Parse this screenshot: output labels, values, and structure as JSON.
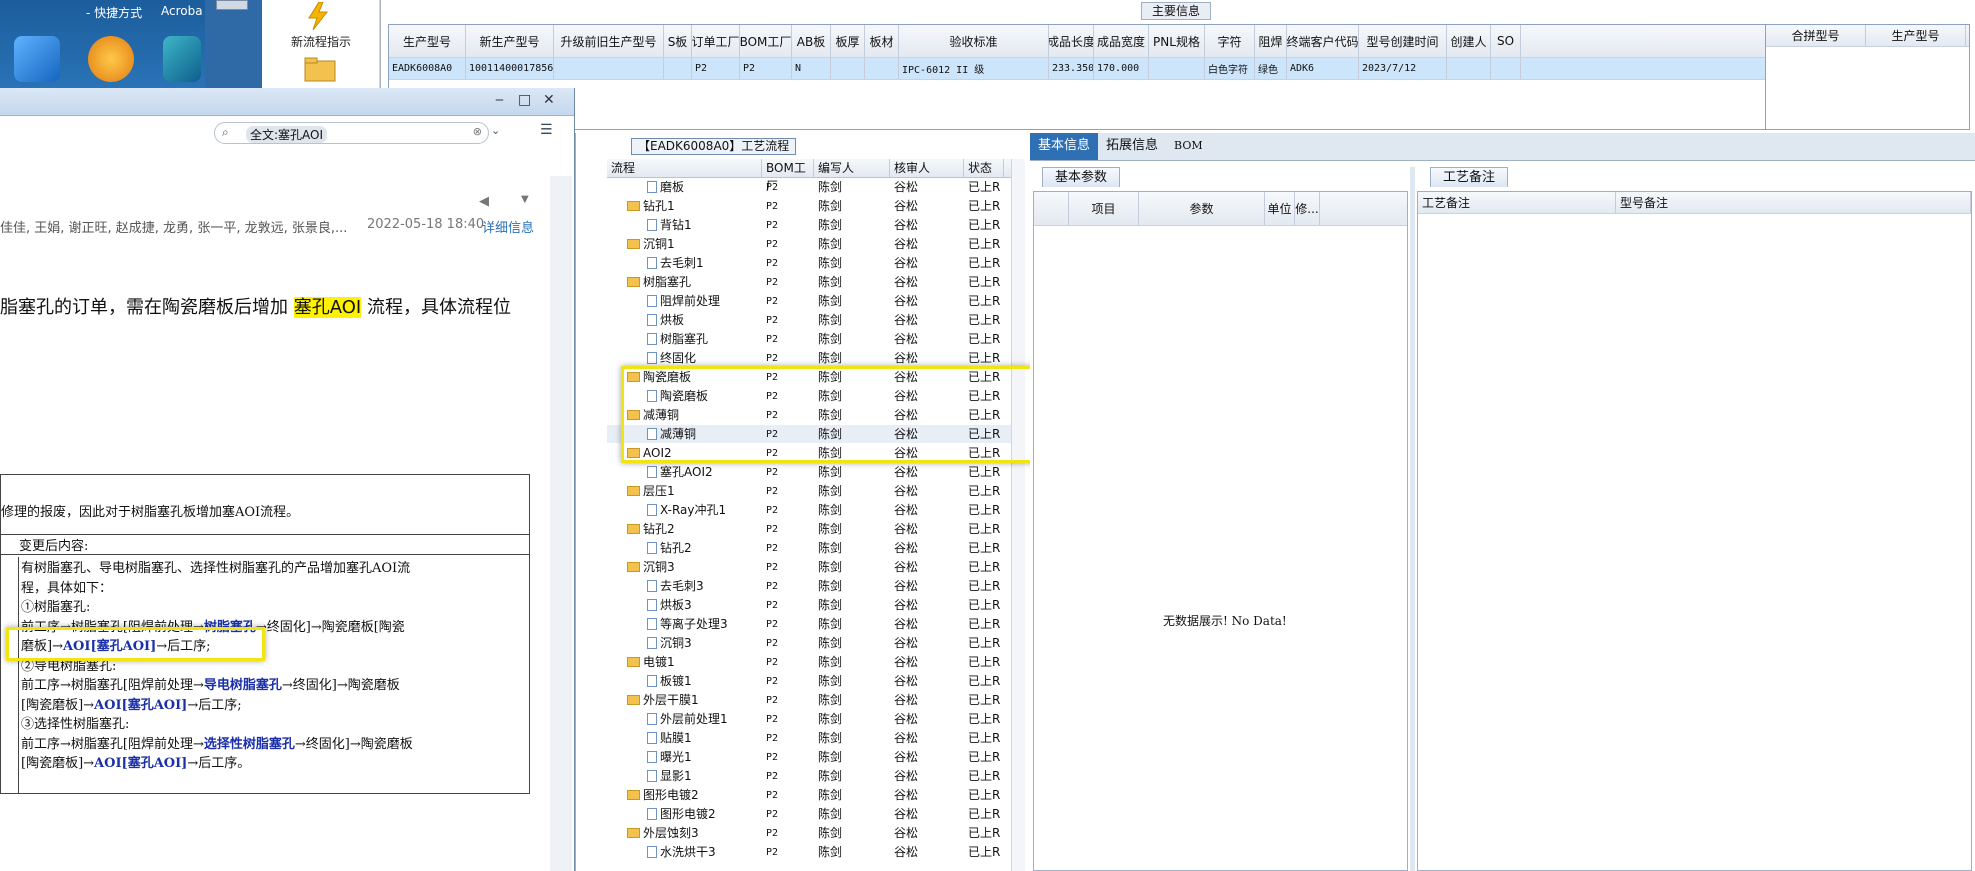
{
  "desktop": {
    "shortcut_label": "- 快捷方式",
    "acrobat_label": "Acroba",
    "launcher_label": "新流程指示"
  },
  "main_info": {
    "section_title": "主要信息",
    "columns": [
      "生产型号",
      "新生产型号",
      "升级前旧生产型号",
      "S板",
      "订单工厂",
      "BOM工厂",
      "AB板",
      "板厚",
      "板材",
      "验收标准",
      "成品长度",
      "成品宽度",
      "PNL规格",
      "字符",
      "阻焊",
      "终端客户代码",
      "型号创建时间",
      "创建人",
      "SO"
    ],
    "row": [
      "EADK6008A0",
      "10011400017856",
      "",
      "",
      "P2",
      "P2",
      "N",
      "",
      "",
      "IPC-6012 II 级",
      "233.350",
      "170.000",
      "",
      "白色字符",
      "绿色",
      "ADK6",
      "2023/7/12",
      "",
      ""
    ],
    "right_columns": [
      "合拼型号",
      "生产型号"
    ]
  },
  "chat": {
    "search_value": "全文:塞孔AOI",
    "sender_line": "佳佳, 王娟, 谢正旺, 赵成捷, 龙勇, 张一平, 龙敦远, 张景良,...",
    "time": "2022-05-18 18:40",
    "detail_link": "详细信息",
    "headline_pre": "脂塞孔的订单，需在陶瓷磨板后增加 ",
    "headline_hl": "塞孔AOI",
    "headline_post": " 流程，具体流程位",
    "reason": "修理的报废，因此对于树脂塞孔板增加塞AOI流程。",
    "after_label": "变更后内容:",
    "body_l1": "有树脂塞孔、导电树脂塞孔、选择性树脂塞孔的产品增加塞孔AOI流",
    "body_l2": "程，具体如下：",
    "body_l3": "①树脂塞孔:",
    "body_l4a": "前工序→树脂塞孔[阻焊前处理→",
    "body_l4b": "树脂塞孔",
    "body_l4c": "→终固化]→陶瓷磨板[陶瓷",
    "body_l5a": "磨板]→",
    "body_l5b": "AOI[塞孔AOI]",
    "body_l5c": "→后工序;",
    "body_l6": "②导电树脂塞孔:",
    "body_l7a": "前工序→树脂塞孔[阻焊前处理→",
    "body_l7b": "导电树脂塞孔",
    "body_l7c": "→终固化]→陶瓷磨板",
    "body_l8a": "[陶瓷磨板]→",
    "body_l8b": "AOI[塞孔AOI]",
    "body_l8c": "→后工序;",
    "body_l9": "③选择性树脂塞孔:",
    "body_l10a": "前工序→树脂塞孔[阻焊前处理→",
    "body_l10b": "选择性树脂塞孔",
    "body_l10c": "→终固化]→陶瓷磨板",
    "body_l11a": "[陶瓷磨板]→",
    "body_l11b": "AOI[塞孔AOI]",
    "body_l11c": "→后工序。"
  },
  "tree": {
    "tab_title": "【EADK6008A0】工艺流程",
    "columns": [
      "流程",
      "BOM工厂",
      "编写人",
      "核审人",
      "状态"
    ],
    "rows": [
      {
        "name": "磨板",
        "type": "doc",
        "indent": 2,
        "bom": "P2",
        "editor": "陈剑",
        "reviewer": "谷松",
        "status": "已上R"
      },
      {
        "name": "钻孔1",
        "type": "folder",
        "indent": 1,
        "bom": "P2",
        "editor": "陈剑",
        "reviewer": "谷松",
        "status": "已上R"
      },
      {
        "name": "背钻1",
        "type": "doc",
        "indent": 2,
        "bom": "P2",
        "editor": "陈剑",
        "reviewer": "谷松",
        "status": "已上R"
      },
      {
        "name": "沉铜1",
        "type": "folder",
        "indent": 1,
        "bom": "P2",
        "editor": "陈剑",
        "reviewer": "谷松",
        "status": "已上R"
      },
      {
        "name": "去毛刺1",
        "type": "doc",
        "indent": 2,
        "bom": "P2",
        "editor": "陈剑",
        "reviewer": "谷松",
        "status": "已上R"
      },
      {
        "name": "树脂塞孔",
        "type": "folder",
        "indent": 1,
        "bom": "P2",
        "editor": "陈剑",
        "reviewer": "谷松",
        "status": "已上R"
      },
      {
        "name": "阻焊前处理",
        "type": "doc",
        "indent": 2,
        "bom": "P2",
        "editor": "陈剑",
        "reviewer": "谷松",
        "status": "已上R"
      },
      {
        "name": "烘板",
        "type": "doc",
        "indent": 2,
        "bom": "P2",
        "editor": "陈剑",
        "reviewer": "谷松",
        "status": "已上R"
      },
      {
        "name": "树脂塞孔",
        "type": "doc",
        "indent": 2,
        "bom": "P2",
        "editor": "陈剑",
        "reviewer": "谷松",
        "status": "已上R"
      },
      {
        "name": "终固化",
        "type": "doc",
        "indent": 2,
        "bom": "P2",
        "editor": "陈剑",
        "reviewer": "谷松",
        "status": "已上R"
      },
      {
        "name": "陶瓷磨板",
        "type": "folder",
        "indent": 1,
        "bom": "P2",
        "editor": "陈剑",
        "reviewer": "谷松",
        "status": "已上R"
      },
      {
        "name": "陶瓷磨板",
        "type": "doc",
        "indent": 2,
        "bom": "P2",
        "editor": "陈剑",
        "reviewer": "谷松",
        "status": "已上R"
      },
      {
        "name": "减薄铜",
        "type": "folder",
        "indent": 1,
        "bom": "P2",
        "editor": "陈剑",
        "reviewer": "谷松",
        "status": "已上R"
      },
      {
        "name": "减薄铜",
        "type": "doc",
        "indent": 2,
        "bom": "P2",
        "editor": "陈剑",
        "reviewer": "谷松",
        "status": "已上R"
      },
      {
        "name": "AOI2",
        "type": "folder",
        "indent": 1,
        "bom": "P2",
        "editor": "陈剑",
        "reviewer": "谷松",
        "status": "已上R"
      },
      {
        "name": "塞孔AOI2",
        "type": "doc",
        "indent": 2,
        "bom": "P2",
        "editor": "陈剑",
        "reviewer": "谷松",
        "status": "已上R"
      },
      {
        "name": "层压1",
        "type": "folder",
        "indent": 1,
        "bom": "P2",
        "editor": "陈剑",
        "reviewer": "谷松",
        "status": "已上R"
      },
      {
        "name": "X-Ray冲孔1",
        "type": "doc",
        "indent": 2,
        "bom": "P2",
        "editor": "陈剑",
        "reviewer": "谷松",
        "status": "已上R"
      },
      {
        "name": "钻孔2",
        "type": "folder",
        "indent": 1,
        "bom": "P2",
        "editor": "陈剑",
        "reviewer": "谷松",
        "status": "已上R"
      },
      {
        "name": "钻孔2",
        "type": "doc",
        "indent": 2,
        "bom": "P2",
        "editor": "陈剑",
        "reviewer": "谷松",
        "status": "已上R"
      },
      {
        "name": "沉铜3",
        "type": "folder",
        "indent": 1,
        "bom": "P2",
        "editor": "陈剑",
        "reviewer": "谷松",
        "status": "已上R"
      },
      {
        "name": "去毛刺3",
        "type": "doc",
        "indent": 2,
        "bom": "P2",
        "editor": "陈剑",
        "reviewer": "谷松",
        "status": "已上R"
      },
      {
        "name": "烘板3",
        "type": "doc",
        "indent": 2,
        "bom": "P2",
        "editor": "陈剑",
        "reviewer": "谷松",
        "status": "已上R"
      },
      {
        "name": "等离子处理3",
        "type": "doc",
        "indent": 2,
        "bom": "P2",
        "editor": "陈剑",
        "reviewer": "谷松",
        "status": "已上R"
      },
      {
        "name": "沉铜3",
        "type": "doc",
        "indent": 2,
        "bom": "P2",
        "editor": "陈剑",
        "reviewer": "谷松",
        "status": "已上R"
      },
      {
        "name": "电镀1",
        "type": "folder",
        "indent": 1,
        "bom": "P2",
        "editor": "陈剑",
        "reviewer": "谷松",
        "status": "已上R"
      },
      {
        "name": "板镀1",
        "type": "doc",
        "indent": 2,
        "bom": "P2",
        "editor": "陈剑",
        "reviewer": "谷松",
        "status": "已上R"
      },
      {
        "name": "外层干膜1",
        "type": "folder",
        "indent": 1,
        "bom": "P2",
        "editor": "陈剑",
        "reviewer": "谷松",
        "status": "已上R"
      },
      {
        "name": "外层前处理1",
        "type": "doc",
        "indent": 2,
        "bom": "P2",
        "editor": "陈剑",
        "reviewer": "谷松",
        "status": "已上R"
      },
      {
        "name": "贴膜1",
        "type": "doc",
        "indent": 2,
        "bom": "P2",
        "editor": "陈剑",
        "reviewer": "谷松",
        "status": "已上R"
      },
      {
        "name": "曝光1",
        "type": "doc",
        "indent": 2,
        "bom": "P2",
        "editor": "陈剑",
        "reviewer": "谷松",
        "status": "已上R"
      },
      {
        "name": "显影1",
        "type": "doc",
        "indent": 2,
        "bom": "P2",
        "editor": "陈剑",
        "reviewer": "谷松",
        "status": "已上R"
      },
      {
        "name": "图形电镀2",
        "type": "folder",
        "indent": 1,
        "bom": "P2",
        "editor": "陈剑",
        "reviewer": "谷松",
        "status": "已上R"
      },
      {
        "name": "图形电镀2",
        "type": "doc",
        "indent": 2,
        "bom": "P2",
        "editor": "陈剑",
        "reviewer": "谷松",
        "status": "已上R"
      },
      {
        "name": "外层蚀刻3",
        "type": "folder",
        "indent": 1,
        "bom": "P2",
        "editor": "陈剑",
        "reviewer": "谷松",
        "status": "已上R"
      },
      {
        "name": "水洗烘干3",
        "type": "doc",
        "indent": 2,
        "bom": "P2",
        "editor": "陈剑",
        "reviewer": "谷松",
        "status": "已上R"
      }
    ]
  },
  "info": {
    "tabs": [
      "基本信息",
      "拓展信息",
      "BOM"
    ],
    "sub_tab_params": "基本参数",
    "param_columns": [
      "项目",
      "参数",
      "单位",
      "修..."
    ],
    "no_data": "无数据展示! No Data!",
    "sub_tab_remarks": "工艺备注",
    "remark_columns": [
      "工艺备注",
      "型号备注"
    ]
  }
}
